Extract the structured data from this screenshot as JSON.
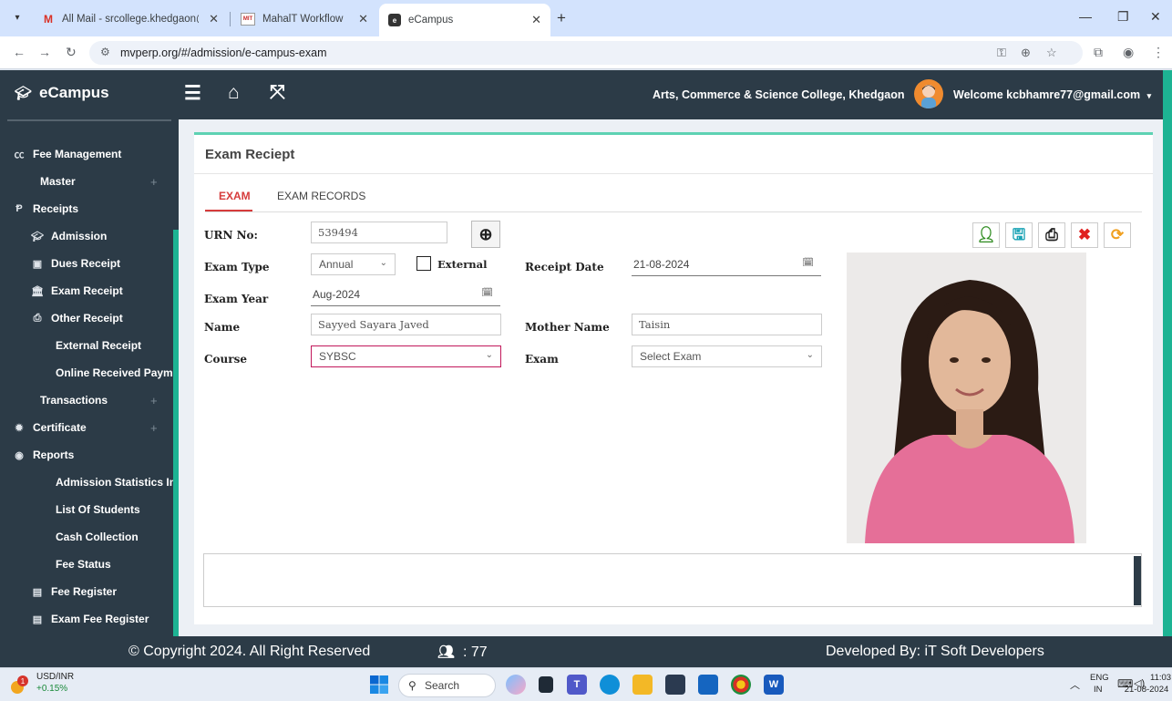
{
  "browser": {
    "tabs": [
      {
        "title": "All Mail - srcollege.khedgaon@",
        "icon": "gmail-icon"
      },
      {
        "title": "MahalT Workflow",
        "icon": "mahait-icon"
      },
      {
        "title": "eCampus",
        "icon": "ecampus-icon"
      }
    ],
    "url": "mvperp.org/#/admission/e-campus-exam"
  },
  "header": {
    "brand": "eCampus",
    "college": "Arts, Commerce & Science College, Khedgaon",
    "welcome": "Welcome kcbhamre77@gmail.com"
  },
  "sidebar": {
    "items": [
      {
        "label": "Fee Management",
        "icon": "cc-icon",
        "level": 0,
        "expandable": false
      },
      {
        "label": "Master",
        "icon": "",
        "level": 1,
        "expandable": true
      },
      {
        "label": "Receipts",
        "icon": "paypal-icon",
        "level": 0,
        "expandable": false
      },
      {
        "label": "Admission",
        "icon": "graduation-cap-icon",
        "level": 1,
        "expandable": false
      },
      {
        "label": "Dues Receipt",
        "icon": "money-icon",
        "level": 1,
        "expandable": false
      },
      {
        "label": "Exam Receipt",
        "icon": "bank-icon",
        "level": 1,
        "expandable": false
      },
      {
        "label": "Other Receipt",
        "icon": "print-icon",
        "level": 1,
        "expandable": false
      },
      {
        "label": "External Receipt",
        "icon": "",
        "level": 2,
        "expandable": false
      },
      {
        "label": "Online Received Payment",
        "icon": "",
        "level": 2,
        "expandable": false
      },
      {
        "label": "Transactions",
        "icon": "",
        "level": 1,
        "expandable": true
      },
      {
        "label": "Certificate",
        "icon": "gear-icon",
        "level": 0,
        "expandable": true
      },
      {
        "label": "Reports",
        "icon": "eye-icon",
        "level": 0,
        "expandable": false
      },
      {
        "label": "Admission Statistics Info",
        "icon": "",
        "level": 2,
        "expandable": false
      },
      {
        "label": "List Of Students",
        "icon": "",
        "level": 2,
        "expandable": false
      },
      {
        "label": "Cash Collection",
        "icon": "",
        "level": 2,
        "expandable": false
      },
      {
        "label": "Fee Status",
        "icon": "",
        "level": 2,
        "expandable": false
      },
      {
        "label": "Fee Register",
        "icon": "register-icon",
        "level": 1,
        "expandable": false
      },
      {
        "label": "Exam Fee Register",
        "icon": "register-icon",
        "level": 1,
        "expandable": false
      }
    ]
  },
  "panel": {
    "title": "Exam Reciept",
    "tabs": [
      "EXAM",
      "EXAM RECORDS"
    ]
  },
  "form": {
    "urn_label": "URN No:",
    "urn_value": "539494",
    "exam_type_label": "Exam Type",
    "exam_type_value": "Annual",
    "external_label": "External",
    "receipt_date_label": "Receipt Date",
    "receipt_date_value": "21-08-2024",
    "exam_year_label": "Exam Year",
    "exam_year_value": "Aug-2024",
    "name_label": "Name",
    "name_value": "Sayyed Sayara Javed",
    "mother_label": "Mother Name",
    "mother_value": "Taisin",
    "course_label": "Course",
    "course_value": "SYBSC",
    "exam_label": "Exam",
    "exam_value": "Select Exam"
  },
  "footer": {
    "copyright": "© Copyright 2024. All Right Reserved",
    "user_count": ": 77",
    "developed_by": "Developed By: iT Soft Developers"
  },
  "taskbar": {
    "ticker_name": "USD/INR",
    "ticker_change": "+0.15%",
    "search": "Search",
    "lang_top": "ENG",
    "lang_bottom": "IN",
    "time": "11:03",
    "date": "21-08-2024"
  },
  "colors": {
    "header_bg": "#2c3b47",
    "accent_teal": "#1db393",
    "active_tab": "#d63b3b"
  }
}
